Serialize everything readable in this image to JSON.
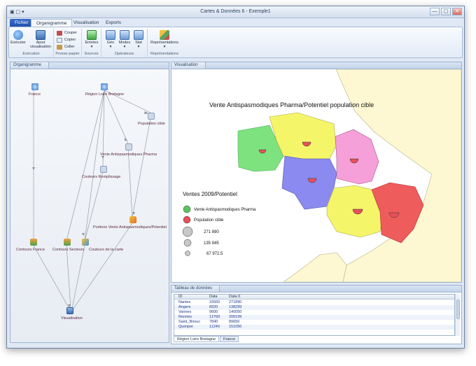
{
  "window": {
    "title": "Cartes & Données 6 - Exemple1",
    "quick_access": "▣ ▢ ▾",
    "minimize": "—",
    "maximize": "▢",
    "close": "✕"
  },
  "tabs": [
    {
      "label": "Fichier"
    },
    {
      "label": "Organigramme"
    },
    {
      "label": "Visualisation"
    },
    {
      "label": "Exports"
    }
  ],
  "ribbon": {
    "groups": {
      "execution": "Exécution",
      "presse_papier": "Presse-papier",
      "sources": "Sources",
      "operateurs": "Opérateurs",
      "representations": "Représentations"
    },
    "executer": "Exécuter",
    "ajout_visualisation_1": "Ajout",
    "ajout_visualisation_2": "visualisation",
    "couper": "Couper",
    "copier": "Copier",
    "coller": "Coller",
    "entrees": "Entrées",
    "geo": "Géo",
    "modes": "Modes",
    "stat": "Stat",
    "representations_btn": "Représentations",
    "dropdown": "▾"
  },
  "organigramme": {
    "title": "Organigramme",
    "nodes": {
      "france": "France",
      "region": "Région Loire Bretagne",
      "population": "Population cible",
      "vente": "Vente Antispasmodiques Pharma",
      "couleurs": "Couleurs Remplissage",
      "portions": "Portions Vente Antispasmodiques/Potentiel",
      "contours_france": "Contours France",
      "contours_secteurs": "Contours Secteurs",
      "couleurs_carte": "Couleurs de la carte",
      "visualisation": "Visualisation"
    }
  },
  "visualisation": {
    "title": "Visualisation",
    "map_title": "Vente Antispasmodiques Pharma/Potentiel population cible",
    "legend_title": "Ventes 2009/Potentiel",
    "legend_items": [
      {
        "label": "Vente Antispasmodiques Pharma",
        "color": "#5cc45c"
      },
      {
        "label": "Population cible",
        "color": "#e8505a"
      }
    ],
    "size_values": [
      "271 890",
      "135 945",
      "67 972.5"
    ],
    "region_colors": [
      "#7ee27e",
      "#f5f56a",
      "#8a8af0",
      "#f5a0d8",
      "#f5f56a",
      "#ee5c5c"
    ]
  },
  "tableau": {
    "title": "Tableau de données",
    "columns": [
      "ID",
      "Data",
      "Data 0"
    ],
    "rows": [
      [
        "Nantes",
        "16560",
        "271890"
      ],
      [
        "Angers",
        "8320",
        "138299"
      ],
      [
        "Vannes",
        "9600",
        "140050"
      ],
      [
        "Rennes",
        "12760",
        "206199"
      ],
      [
        "Saint_Brieuc",
        "7840",
        "89656"
      ],
      [
        "Quimper",
        "11240",
        "151050"
      ]
    ],
    "sheet_tabs": [
      "Région Loire Bretagne",
      "France"
    ]
  }
}
